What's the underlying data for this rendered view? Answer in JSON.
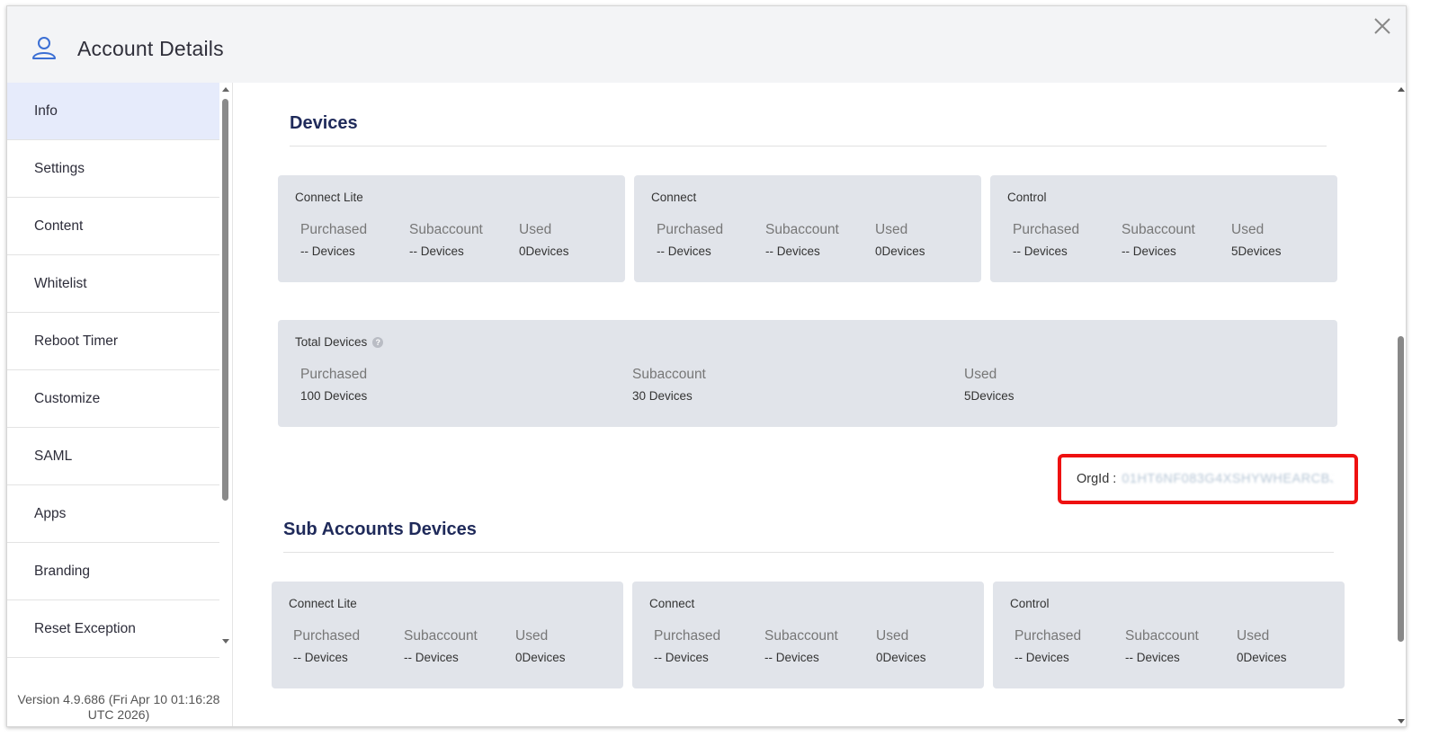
{
  "dialog": {
    "title": "Account Details"
  },
  "sidebar": {
    "items": [
      {
        "label": "Info",
        "active": true
      },
      {
        "label": "Settings"
      },
      {
        "label": "Content"
      },
      {
        "label": "Whitelist"
      },
      {
        "label": "Reboot Timer"
      },
      {
        "label": "Customize"
      },
      {
        "label": "SAML"
      },
      {
        "label": "Apps"
      },
      {
        "label": "Branding"
      },
      {
        "label": "Reset Exception"
      }
    ],
    "version_line1": "Version 4.9.686 (Fri Apr 10 01:16:28",
    "version_line2": "UTC 2026)"
  },
  "devices": {
    "title": "Devices",
    "cards": [
      {
        "title": "Connect Lite",
        "purchased_label": "Purchased",
        "purchased": "-- Devices",
        "subaccount_label": "Subaccount",
        "subaccount": "-- Devices",
        "used_label": "Used",
        "used": "0Devices"
      },
      {
        "title": "Connect",
        "purchased_label": "Purchased",
        "purchased": "-- Devices",
        "subaccount_label": "Subaccount",
        "subaccount": "-- Devices",
        "used_label": "Used",
        "used": "0Devices"
      },
      {
        "title": "Control",
        "purchased_label": "Purchased",
        "purchased": "-- Devices",
        "subaccount_label": "Subaccount",
        "subaccount": "-- Devices",
        "used_label": "Used",
        "used": "5Devices"
      }
    ],
    "total": {
      "title": "Total Devices",
      "help": "?",
      "purchased_label": "Purchased",
      "purchased": "100 Devices",
      "subaccount_label": "Subaccount",
      "subaccount": "30 Devices",
      "used_label": "Used",
      "used": "5Devices"
    }
  },
  "orgid": {
    "label": "OrgId :",
    "value": "01HT6NF083G4XSHYWHEARCBJBG"
  },
  "sub_accounts": {
    "title": "Sub Accounts Devices",
    "cards": [
      {
        "title": "Connect Lite",
        "purchased_label": "Purchased",
        "purchased": "-- Devices",
        "subaccount_label": "Subaccount",
        "subaccount": "-- Devices",
        "used_label": "Used",
        "used": "0Devices"
      },
      {
        "title": "Connect",
        "purchased_label": "Purchased",
        "purchased": "-- Devices",
        "subaccount_label": "Subaccount",
        "subaccount": "-- Devices",
        "used_label": "Used",
        "used": "0Devices"
      },
      {
        "title": "Control",
        "purchased_label": "Purchased",
        "purchased": "-- Devices",
        "subaccount_label": "Subaccount",
        "subaccount": "-- Devices",
        "used_label": "Used",
        "used": "0Devices"
      }
    ]
  },
  "colors": {
    "accent": "#3b6fd4",
    "active_nav": "#e6ebfb",
    "card_bg": "#e1e4ea",
    "highlight": "#ee1111"
  },
  "icons": {
    "header": "user-icon",
    "close": "close-icon",
    "help": "help-icon"
  }
}
